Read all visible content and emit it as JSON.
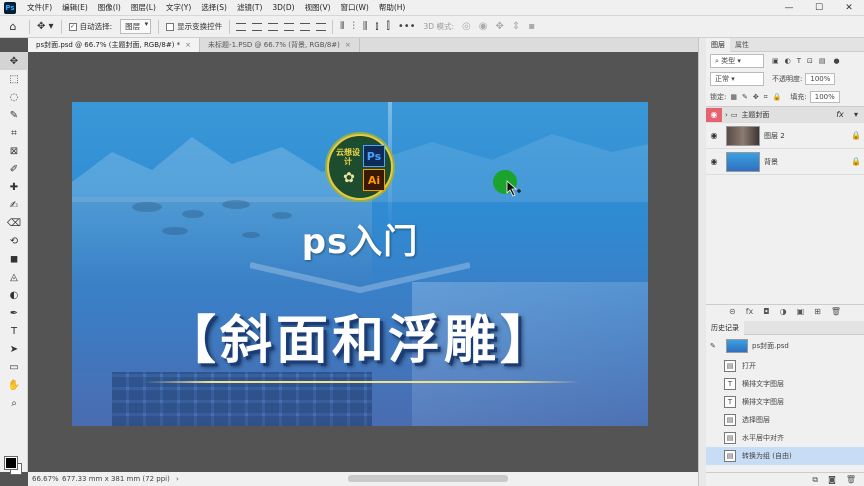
{
  "menu": {
    "items": [
      "文件(F)",
      "编辑(E)",
      "图像(I)",
      "图层(L)",
      "文字(Y)",
      "选择(S)",
      "滤镜(T)",
      "3D(D)",
      "视图(V)",
      "窗口(W)",
      "帮助(H)"
    ],
    "window_controls": [
      "—",
      "☐",
      "✕"
    ]
  },
  "options": {
    "auto_select_label": "自动选择:",
    "layer_dropdown": "图层",
    "show_transform_label": "显示变换控件",
    "mode_3d_label": "3D 模式:",
    "more": "•••"
  },
  "tabs": [
    {
      "label": "ps封面.psd @ 66.7% (主题封面, RGB/8#) *",
      "active": true
    },
    {
      "label": "未标题-1.PSD @ 66.7% (背景, RGB/8#)",
      "active": false
    }
  ],
  "tools": [
    "✥",
    "⬚",
    "◌",
    "✎",
    "⌗",
    "⊠",
    "✐",
    "✚",
    "✍",
    "⌫",
    "⟲",
    "◼",
    "◬",
    "◐",
    "✒",
    "T",
    "➤",
    "▭",
    "✋",
    "⌕"
  ],
  "canvas": {
    "subtitle": "ps入门",
    "headline": "【斜面和浮雕】",
    "logo_cn": "云想设计",
    "logo_ps": "Ps",
    "logo_ai": "Ai",
    "colors": {
      "accent_dot": "#1aa42c",
      "headline_shadow": "#1a3d78",
      "underline": "#f3e08a"
    }
  },
  "status": {
    "zoom": "66.67%",
    "dims": "677.33 mm x 381 mm (72 ppi)"
  },
  "layers_panel": {
    "tabs": [
      "图层",
      "属性"
    ],
    "filter_label": "类型",
    "blend_mode": "正常",
    "opacity_label": "不透明度:",
    "opacity_value": "100%",
    "lock_label": "锁定:",
    "fill_label": "填充:",
    "fill_value": "100%",
    "layers": [
      {
        "name": "主题封面",
        "type": "group",
        "fx": "fx",
        "selected": true
      },
      {
        "name": "图层 2",
        "type": "image",
        "fx": "",
        "selected": false
      },
      {
        "name": "背景",
        "type": "bg",
        "fx": "",
        "selected": false
      }
    ],
    "footer_icons": [
      "⊝",
      "fx",
      "◘",
      "◑",
      "▣",
      "⊞",
      "🗑"
    ]
  },
  "history_panel": {
    "tabs": [
      "历史记录"
    ],
    "doc": "ps封面.psd",
    "items": [
      {
        "label": "打开",
        "icon": "▤",
        "selected": false
      },
      {
        "label": "横排文字图层",
        "icon": "T",
        "selected": false
      },
      {
        "label": "横排文字图层",
        "icon": "T",
        "selected": false
      },
      {
        "label": "选择图层",
        "icon": "▤",
        "selected": false
      },
      {
        "label": "水平居中对齐",
        "icon": "▤",
        "selected": false
      },
      {
        "label": "转换为组 (自由)",
        "icon": "▤",
        "selected": true
      }
    ]
  }
}
